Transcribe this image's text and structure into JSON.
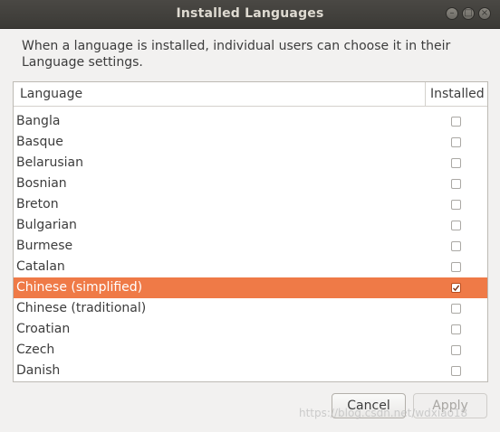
{
  "window": {
    "title": "Installed Languages",
    "controls": {
      "minimize": "–",
      "maximize": "□",
      "close": "×"
    }
  },
  "description": "When a language is installed, individual users can choose it in their Language settings.",
  "list": {
    "columns": {
      "language": "Language",
      "installed": "Installed"
    },
    "rows": [
      {
        "label": "Bangla",
        "installed": false,
        "selected": false
      },
      {
        "label": "Basque",
        "installed": false,
        "selected": false
      },
      {
        "label": "Belarusian",
        "installed": false,
        "selected": false
      },
      {
        "label": "Bosnian",
        "installed": false,
        "selected": false
      },
      {
        "label": "Breton",
        "installed": false,
        "selected": false
      },
      {
        "label": "Bulgarian",
        "installed": false,
        "selected": false
      },
      {
        "label": "Burmese",
        "installed": false,
        "selected": false
      },
      {
        "label": "Catalan",
        "installed": false,
        "selected": false
      },
      {
        "label": "Chinese (simplified)",
        "installed": true,
        "selected": true
      },
      {
        "label": "Chinese (traditional)",
        "installed": false,
        "selected": false
      },
      {
        "label": "Croatian",
        "installed": false,
        "selected": false
      },
      {
        "label": "Czech",
        "installed": false,
        "selected": false
      },
      {
        "label": "Danish",
        "installed": false,
        "selected": false
      }
    ]
  },
  "buttons": {
    "cancel": "Cancel",
    "apply": "Apply"
  },
  "watermark": "https://blog.csdn.net/wdxiao18",
  "colors": {
    "selection": "#ef7a47",
    "titlebar": "#3b3a36"
  }
}
